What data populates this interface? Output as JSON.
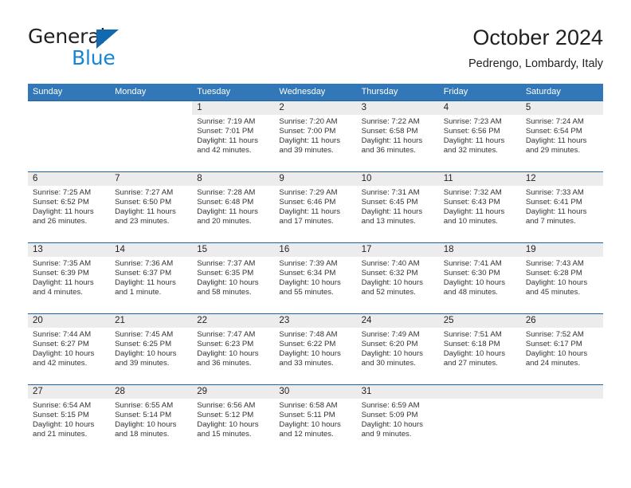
{
  "brand": {
    "name_top": "General",
    "name_bottom": "Blue",
    "accent_color": "#1585d6",
    "triangle_color": "#1269b0"
  },
  "header": {
    "title": "October 2024",
    "subtitle": "Pedrengo, Lombardy, Italy"
  },
  "theme": {
    "header_bar_color": "#3277b8",
    "week_divider_color": "#1d63a4",
    "daynum_band_color": "#ececec",
    "text_color": "#231f20"
  },
  "weekdays": [
    "Sunday",
    "Monday",
    "Tuesday",
    "Wednesday",
    "Thursday",
    "Friday",
    "Saturday"
  ],
  "labels": {
    "sunrise_prefix": "Sunrise:",
    "sunset_prefix": "Sunset:",
    "daylight_prefix": "Daylight:"
  },
  "weeks": [
    [
      {
        "day": "",
        "sunrise": "",
        "sunset": "",
        "daylight_line1": "",
        "daylight_line2": ""
      },
      {
        "day": "",
        "sunrise": "",
        "sunset": "",
        "daylight_line1": "",
        "daylight_line2": ""
      },
      {
        "day": "1",
        "sunrise": "Sunrise: 7:19 AM",
        "sunset": "Sunset: 7:01 PM",
        "daylight_line1": "Daylight: 11 hours",
        "daylight_line2": "and 42 minutes."
      },
      {
        "day": "2",
        "sunrise": "Sunrise: 7:20 AM",
        "sunset": "Sunset: 7:00 PM",
        "daylight_line1": "Daylight: 11 hours",
        "daylight_line2": "and 39 minutes."
      },
      {
        "day": "3",
        "sunrise": "Sunrise: 7:22 AM",
        "sunset": "Sunset: 6:58 PM",
        "daylight_line1": "Daylight: 11 hours",
        "daylight_line2": "and 36 minutes."
      },
      {
        "day": "4",
        "sunrise": "Sunrise: 7:23 AM",
        "sunset": "Sunset: 6:56 PM",
        "daylight_line1": "Daylight: 11 hours",
        "daylight_line2": "and 32 minutes."
      },
      {
        "day": "5",
        "sunrise": "Sunrise: 7:24 AM",
        "sunset": "Sunset: 6:54 PM",
        "daylight_line1": "Daylight: 11 hours",
        "daylight_line2": "and 29 minutes."
      }
    ],
    [
      {
        "day": "6",
        "sunrise": "Sunrise: 7:25 AM",
        "sunset": "Sunset: 6:52 PM",
        "daylight_line1": "Daylight: 11 hours",
        "daylight_line2": "and 26 minutes."
      },
      {
        "day": "7",
        "sunrise": "Sunrise: 7:27 AM",
        "sunset": "Sunset: 6:50 PM",
        "daylight_line1": "Daylight: 11 hours",
        "daylight_line2": "and 23 minutes."
      },
      {
        "day": "8",
        "sunrise": "Sunrise: 7:28 AM",
        "sunset": "Sunset: 6:48 PM",
        "daylight_line1": "Daylight: 11 hours",
        "daylight_line2": "and 20 minutes."
      },
      {
        "day": "9",
        "sunrise": "Sunrise: 7:29 AM",
        "sunset": "Sunset: 6:46 PM",
        "daylight_line1": "Daylight: 11 hours",
        "daylight_line2": "and 17 minutes."
      },
      {
        "day": "10",
        "sunrise": "Sunrise: 7:31 AM",
        "sunset": "Sunset: 6:45 PM",
        "daylight_line1": "Daylight: 11 hours",
        "daylight_line2": "and 13 minutes."
      },
      {
        "day": "11",
        "sunrise": "Sunrise: 7:32 AM",
        "sunset": "Sunset: 6:43 PM",
        "daylight_line1": "Daylight: 11 hours",
        "daylight_line2": "and 10 minutes."
      },
      {
        "day": "12",
        "sunrise": "Sunrise: 7:33 AM",
        "sunset": "Sunset: 6:41 PM",
        "daylight_line1": "Daylight: 11 hours",
        "daylight_line2": "and 7 minutes."
      }
    ],
    [
      {
        "day": "13",
        "sunrise": "Sunrise: 7:35 AM",
        "sunset": "Sunset: 6:39 PM",
        "daylight_line1": "Daylight: 11 hours",
        "daylight_line2": "and 4 minutes."
      },
      {
        "day": "14",
        "sunrise": "Sunrise: 7:36 AM",
        "sunset": "Sunset: 6:37 PM",
        "daylight_line1": "Daylight: 11 hours",
        "daylight_line2": "and 1 minute."
      },
      {
        "day": "15",
        "sunrise": "Sunrise: 7:37 AM",
        "sunset": "Sunset: 6:35 PM",
        "daylight_line1": "Daylight: 10 hours",
        "daylight_line2": "and 58 minutes."
      },
      {
        "day": "16",
        "sunrise": "Sunrise: 7:39 AM",
        "sunset": "Sunset: 6:34 PM",
        "daylight_line1": "Daylight: 10 hours",
        "daylight_line2": "and 55 minutes."
      },
      {
        "day": "17",
        "sunrise": "Sunrise: 7:40 AM",
        "sunset": "Sunset: 6:32 PM",
        "daylight_line1": "Daylight: 10 hours",
        "daylight_line2": "and 52 minutes."
      },
      {
        "day": "18",
        "sunrise": "Sunrise: 7:41 AM",
        "sunset": "Sunset: 6:30 PM",
        "daylight_line1": "Daylight: 10 hours",
        "daylight_line2": "and 48 minutes."
      },
      {
        "day": "19",
        "sunrise": "Sunrise: 7:43 AM",
        "sunset": "Sunset: 6:28 PM",
        "daylight_line1": "Daylight: 10 hours",
        "daylight_line2": "and 45 minutes."
      }
    ],
    [
      {
        "day": "20",
        "sunrise": "Sunrise: 7:44 AM",
        "sunset": "Sunset: 6:27 PM",
        "daylight_line1": "Daylight: 10 hours",
        "daylight_line2": "and 42 minutes."
      },
      {
        "day": "21",
        "sunrise": "Sunrise: 7:45 AM",
        "sunset": "Sunset: 6:25 PM",
        "daylight_line1": "Daylight: 10 hours",
        "daylight_line2": "and 39 minutes."
      },
      {
        "day": "22",
        "sunrise": "Sunrise: 7:47 AM",
        "sunset": "Sunset: 6:23 PM",
        "daylight_line1": "Daylight: 10 hours",
        "daylight_line2": "and 36 minutes."
      },
      {
        "day": "23",
        "sunrise": "Sunrise: 7:48 AM",
        "sunset": "Sunset: 6:22 PM",
        "daylight_line1": "Daylight: 10 hours",
        "daylight_line2": "and 33 minutes."
      },
      {
        "day": "24",
        "sunrise": "Sunrise: 7:49 AM",
        "sunset": "Sunset: 6:20 PM",
        "daylight_line1": "Daylight: 10 hours",
        "daylight_line2": "and 30 minutes."
      },
      {
        "day": "25",
        "sunrise": "Sunrise: 7:51 AM",
        "sunset": "Sunset: 6:18 PM",
        "daylight_line1": "Daylight: 10 hours",
        "daylight_line2": "and 27 minutes."
      },
      {
        "day": "26",
        "sunrise": "Sunrise: 7:52 AM",
        "sunset": "Sunset: 6:17 PM",
        "daylight_line1": "Daylight: 10 hours",
        "daylight_line2": "and 24 minutes."
      }
    ],
    [
      {
        "day": "27",
        "sunrise": "Sunrise: 6:54 AM",
        "sunset": "Sunset: 5:15 PM",
        "daylight_line1": "Daylight: 10 hours",
        "daylight_line2": "and 21 minutes."
      },
      {
        "day": "28",
        "sunrise": "Sunrise: 6:55 AM",
        "sunset": "Sunset: 5:14 PM",
        "daylight_line1": "Daylight: 10 hours",
        "daylight_line2": "and 18 minutes."
      },
      {
        "day": "29",
        "sunrise": "Sunrise: 6:56 AM",
        "sunset": "Sunset: 5:12 PM",
        "daylight_line1": "Daylight: 10 hours",
        "daylight_line2": "and 15 minutes."
      },
      {
        "day": "30",
        "sunrise": "Sunrise: 6:58 AM",
        "sunset": "Sunset: 5:11 PM",
        "daylight_line1": "Daylight: 10 hours",
        "daylight_line2": "and 12 minutes."
      },
      {
        "day": "31",
        "sunrise": "Sunrise: 6:59 AM",
        "sunset": "Sunset: 5:09 PM",
        "daylight_line1": "Daylight: 10 hours",
        "daylight_line2": "and 9 minutes."
      },
      {
        "day": "",
        "sunrise": "",
        "sunset": "",
        "daylight_line1": "",
        "daylight_line2": ""
      },
      {
        "day": "",
        "sunrise": "",
        "sunset": "",
        "daylight_line1": "",
        "daylight_line2": ""
      }
    ]
  ]
}
